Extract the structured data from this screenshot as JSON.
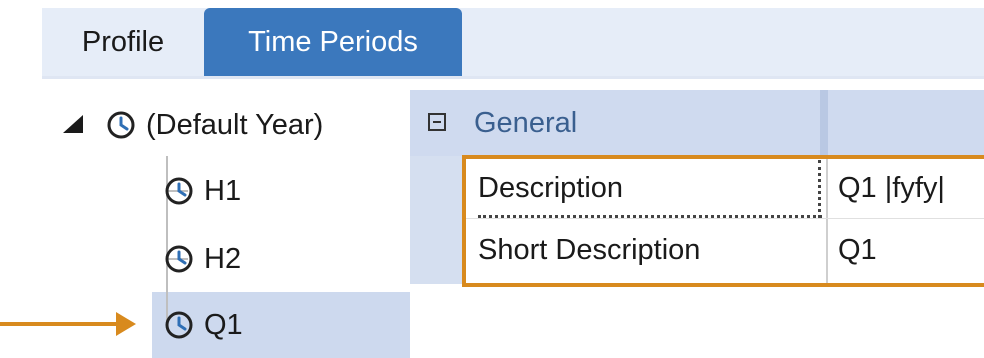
{
  "tabs": [
    {
      "label": "Profile",
      "active": false
    },
    {
      "label": "Time Periods",
      "active": true
    }
  ],
  "tree": {
    "root": {
      "label": "(Default Year)",
      "expanded": true,
      "icon": "clock-icon"
    },
    "children": [
      {
        "label": "H1",
        "icon": "clock-icon"
      },
      {
        "label": "H2",
        "icon": "clock-icon"
      },
      {
        "label": "Q1",
        "icon": "clock-icon",
        "selected": true
      }
    ]
  },
  "grid": {
    "category": "General",
    "rows": [
      {
        "name": "Description",
        "value": "Q1 |fyfy|"
      },
      {
        "name": "Short Description",
        "value": "Q1"
      }
    ]
  },
  "colors": {
    "accent": "#3b78bd",
    "highlight": "#d88a1e",
    "selection": "#cdd9ee"
  }
}
